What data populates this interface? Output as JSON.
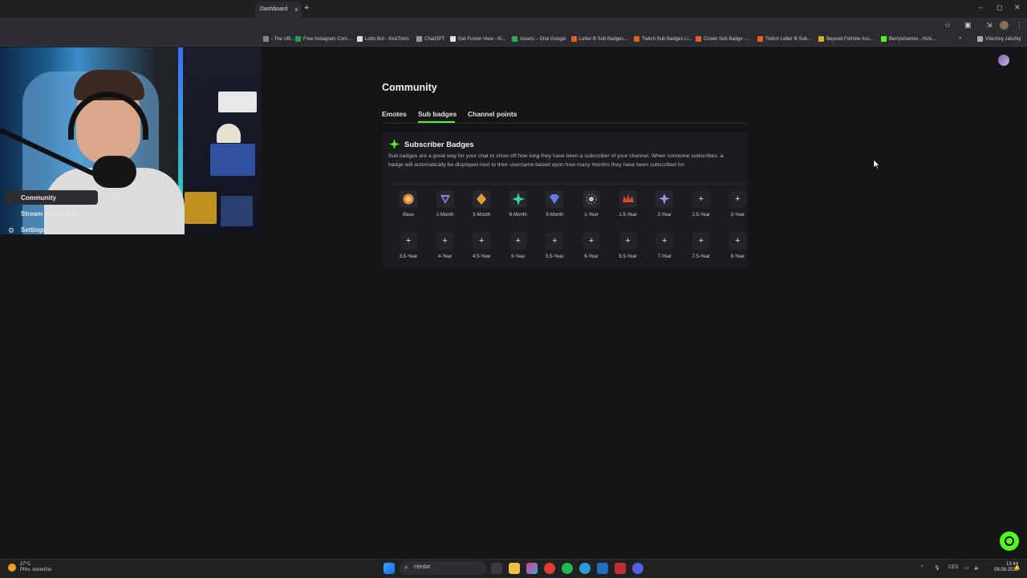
{
  "browser": {
    "tab_title": "Dashboard",
    "bookmarks": [
      {
        "label": "- The Ulti...",
        "color": "#888888"
      },
      {
        "label": "Free Instagram Com...",
        "color": "#2a9d5c"
      },
      {
        "label": "Lotto Bot - KickTools",
        "color": "#e0e0e0"
      },
      {
        "label": "ChatGPT",
        "color": "#9a9a9a"
      },
      {
        "label": "Get Fusion View - Ki...",
        "color": "#e0e0e0"
      },
      {
        "label": "Assets – Disk Google",
        "color": "#34a853"
      },
      {
        "label": "Letter B Sub Badges...",
        "color": "#e06020"
      },
      {
        "label": "Twitch Sub Badges Li...",
        "color": "#e06020"
      },
      {
        "label": "Crown Sub Badge -...",
        "color": "#e06020"
      },
      {
        "label": "Twitch Letter B Sub...",
        "color": "#e06020"
      },
      {
        "label": "Beyond Fortnite Ass...",
        "color": "#d4b020"
      },
      {
        "label": "BerrysGames - Kick...",
        "color": "#53fc18"
      }
    ],
    "more_bookmarks": "»",
    "all_bookmarks": "Všechny záložky"
  },
  "sidebar": {
    "items": [
      {
        "label": "Community"
      },
      {
        "label": "Stream URL & Key"
      },
      {
        "label": "Settings"
      }
    ]
  },
  "main": {
    "title": "Community",
    "tabs": [
      {
        "label": "Emotes"
      },
      {
        "label": "Sub badges"
      },
      {
        "label": "Channel points"
      }
    ],
    "card": {
      "title": "Subscriber Badges",
      "description": "Sub badges are a great way for your chat to show off how long they have been a subscriber of your channel. When someone subscribes, a badge will automatically be displayed next to their username based upon how many months they have been subscribed for.",
      "badges": [
        {
          "label": "Base",
          "icon": "base-badge-icon",
          "color": "#e08a3a"
        },
        {
          "label": "2-Month",
          "icon": "2-month-badge-icon",
          "color": "#8a8ad8"
        },
        {
          "label": "3-Month",
          "icon": "3-month-badge-icon",
          "color": "#e0a030"
        },
        {
          "label": "6-Month",
          "icon": "6-month-badge-icon",
          "color": "#40c8a0"
        },
        {
          "label": "9-Month",
          "icon": "9-month-badge-icon",
          "color": "#6a7ae0"
        },
        {
          "label": "1-Year",
          "icon": "1-year-badge-icon",
          "color": "#c0c0c0"
        },
        {
          "label": "1.5-Year",
          "icon": "1-5-year-badge-icon",
          "color": "#e04a30"
        },
        {
          "label": "2-Year",
          "icon": "2-year-badge-icon",
          "color": "#a890f0"
        },
        {
          "label": "2.5-Year",
          "icon": "plus-icon",
          "color": ""
        },
        {
          "label": "3-Year",
          "icon": "plus-icon",
          "color": ""
        },
        {
          "label": "3.5-Year",
          "icon": "plus-icon",
          "color": ""
        },
        {
          "label": "4-Year",
          "icon": "plus-icon",
          "color": ""
        },
        {
          "label": "4.5-Year",
          "icon": "plus-icon",
          "color": ""
        },
        {
          "label": "5-Year",
          "icon": "plus-icon",
          "color": ""
        },
        {
          "label": "5.5-Year",
          "icon": "plus-icon",
          "color": ""
        },
        {
          "label": "6-Year",
          "icon": "plus-icon",
          "color": ""
        },
        {
          "label": "6.5-Year",
          "icon": "plus-icon",
          "color": ""
        },
        {
          "label": "7-Year",
          "icon": "plus-icon",
          "color": ""
        },
        {
          "label": "7.5-Year",
          "icon": "plus-icon",
          "color": ""
        },
        {
          "label": "8-Year",
          "icon": "plus-icon",
          "color": ""
        }
      ]
    }
  },
  "colors": {
    "accent": "#53fc18",
    "background": "#141517",
    "card": "#1b1c1f"
  },
  "taskbar": {
    "weather_temp": "27°C",
    "weather_desc": "Přev. slunečno",
    "search_placeholder": "Hledat",
    "language": "CES",
    "time": "13:44",
    "date": "08.08.2025"
  }
}
